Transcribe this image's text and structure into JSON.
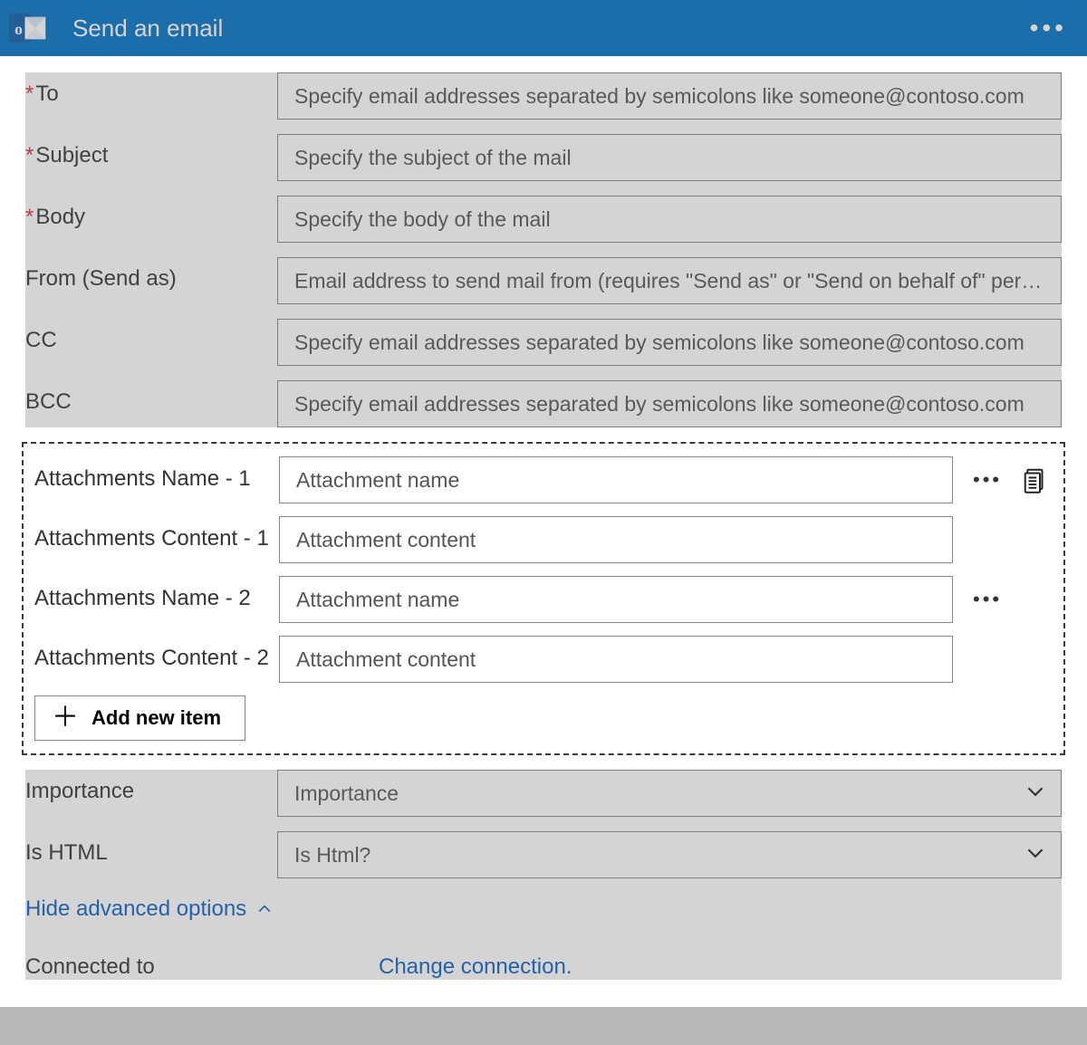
{
  "header": {
    "title": "Send an email"
  },
  "fields": {
    "to": {
      "label": "To",
      "placeholder": "Specify email addresses separated by semicolons like someone@contoso.com",
      "required": true
    },
    "subject": {
      "label": "Subject",
      "placeholder": "Specify the subject of the mail",
      "required": true
    },
    "body": {
      "label": "Body",
      "placeholder": "Specify the body of the mail",
      "required": true
    },
    "from": {
      "label": "From (Send as)",
      "placeholder": "Email address to send mail from (requires \"Send as\" or \"Send on behalf of\" permission)",
      "required": false
    },
    "cc": {
      "label": "CC",
      "placeholder": "Specify email addresses separated by semicolons like someone@contoso.com",
      "required": false
    },
    "bcc": {
      "label": "BCC",
      "placeholder": "Specify email addresses separated by semicolons like someone@contoso.com",
      "required": false
    },
    "importance": {
      "label": "Importance",
      "placeholder": "Importance"
    },
    "ishtml": {
      "label": "Is HTML",
      "placeholder": "Is Html?"
    }
  },
  "attachments": {
    "items": [
      {
        "name_label": "Attachments Name - 1",
        "name_placeholder": "Attachment name",
        "content_label": "Attachments Content - 1",
        "content_placeholder": "Attachment content",
        "show_clipboard": true
      },
      {
        "name_label": "Attachments Name - 2",
        "name_placeholder": "Attachment name",
        "content_label": "Attachments Content - 2",
        "content_placeholder": "Attachment content",
        "show_clipboard": false
      }
    ],
    "add_label": "Add new item"
  },
  "advanced_toggle": "Hide advanced options",
  "connection": {
    "label": "Connected to",
    "link": "Change connection."
  }
}
